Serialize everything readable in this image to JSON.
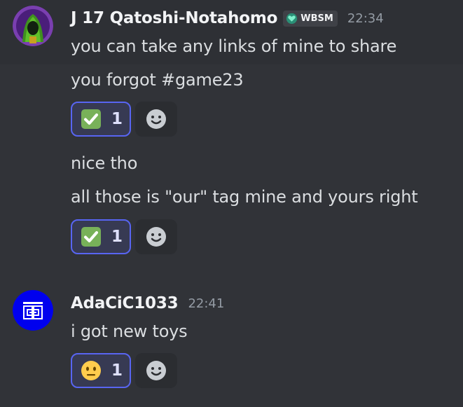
{
  "messages": [
    {
      "author": "J 17 Qatoshi-Notahomo",
      "guild_tag": "WBSM",
      "timestamp": "22:34",
      "lines": [
        "you can take any links of mine to share",
        "you forgot #game23"
      ],
      "reaction": {
        "emoji_icon": "check-mark-button-icon",
        "count": "1"
      }
    },
    {
      "lines": [
        "nice tho",
        "all those is \"our\" tag mine and yours right"
      ],
      "reaction": {
        "emoji_icon": "check-mark-button-icon",
        "count": "1"
      }
    },
    {
      "author": "AdaCiC1033",
      "timestamp": "22:41",
      "lines": [
        "i got new toys"
      ],
      "reaction": {
        "emoji_icon": "neutral-face-icon",
        "count": "1"
      }
    }
  ],
  "colors": {
    "background": "#313338",
    "reaction_border": "#5865f2",
    "reaction_bg": "#373a53",
    "badge_heart": "#3ad9a6",
    "avatar_blue": "#0000ee"
  }
}
